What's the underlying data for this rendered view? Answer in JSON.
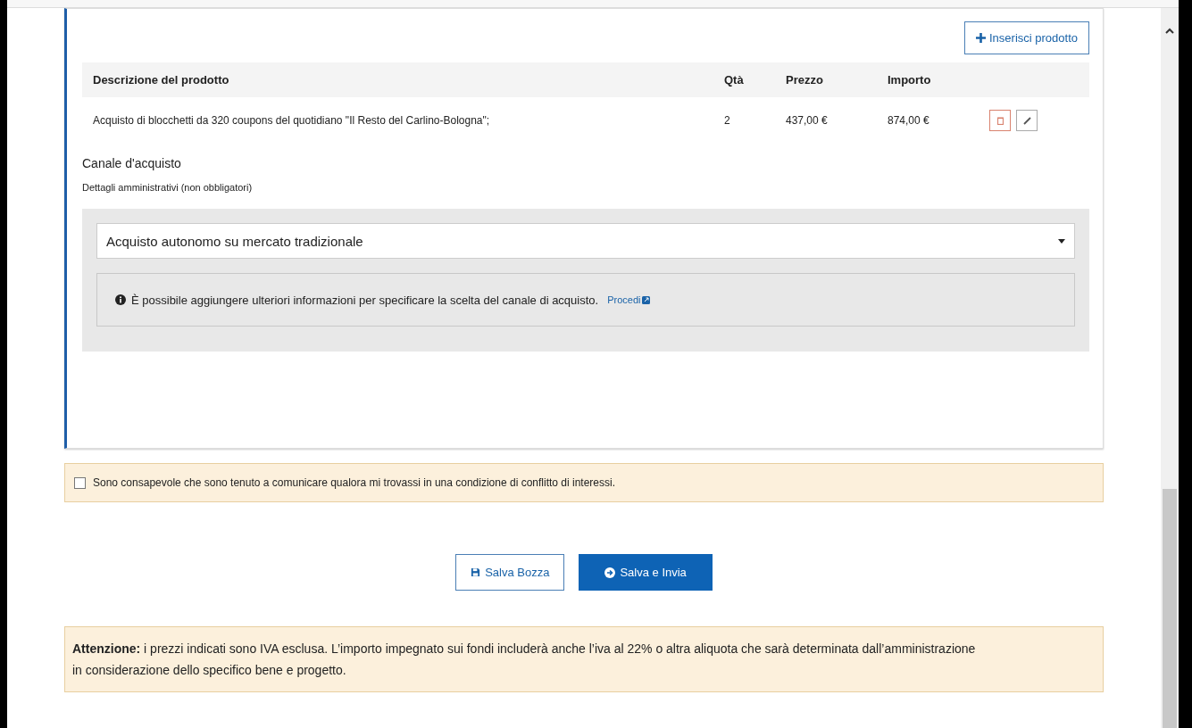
{
  "insert_button": {
    "label": "Inserisci prodotto"
  },
  "table": {
    "columns": [
      "Descrizione del prodotto",
      "Qtà",
      "Prezzo",
      "Importo"
    ],
    "rows": [
      {
        "cells": [
          "Acquisto di blocchetti da 320 coupons del quotidiano \"Il Resto del Carlino-Bologna\";",
          "2",
          "437,00 €",
          "874,00 €"
        ]
      }
    ]
  },
  "channel": {
    "title": "Canale d'acquisto",
    "subtitle": "Dettagli amministrativi (non obbligatori)",
    "select_value": "Acquisto autonomo su mercato tradizionale",
    "info": "È possibile aggiungere ulteriori informazioni per specificare la scelta del canale di acquisto.",
    "info_link": "Procedi"
  },
  "consent": {
    "label": "Sono consapevole che sono tenuto a comunicare qualora mi trovassi in una condizione di conflitto di interessi.",
    "checked": false
  },
  "buttons": [
    {
      "kind": "draft",
      "label": "Salva Bozza"
    },
    {
      "kind": "submit",
      "label": "Salva e Invia"
    }
  ],
  "notice": "**Attenzione:** i prezzi indicati sono IVA esclusa. L’importo impegnato sui fondi includerà anche l’iva al 22% o altra aliquota che sarà determinata dall’amministrazione in considerazione dello specifico bene e progetto."
}
